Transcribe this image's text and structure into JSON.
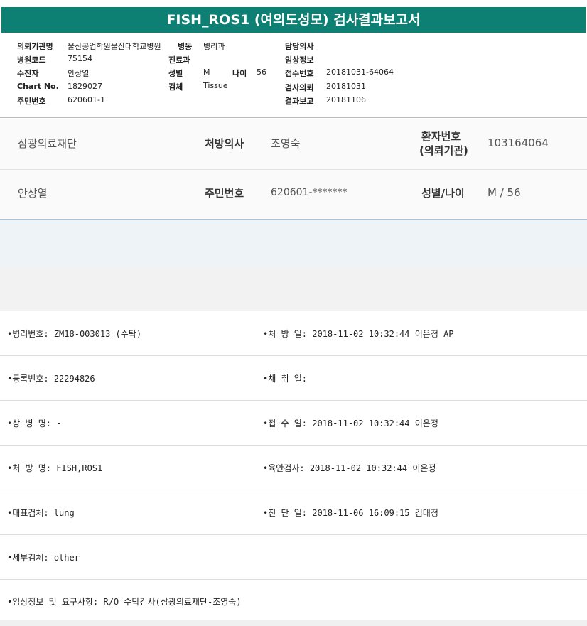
{
  "title": "FISH_ROS1 (여의도성모) 검사결과보고서",
  "header": {
    "institution_label": "의뢰기관명",
    "institution_value": "울산공업학원울산대학교병원",
    "ward_label": "병동",
    "ward_value": "병리과",
    "doctor_label": "담당의사",
    "doctor_value": "",
    "hospital_code_label": "병원코드",
    "hospital_code_value": "75154",
    "dept_label": "진료과",
    "dept_value": "",
    "clinical_info_label": "임상정보",
    "clinical_info_value": "",
    "patient_label": "수진자",
    "patient_value": "안상열",
    "sex_label": "성별",
    "sex_value": "M",
    "age_label": "나이",
    "age_value": "56",
    "receipt_no_label": "접수번호",
    "receipt_no_value": "20181031-64064",
    "chart_label": "Chart No.",
    "chart_value": "1829027",
    "specimen_label": "검체",
    "specimen_value": "Tissue",
    "request_label": "검사의뢰",
    "request_value": "20181031",
    "rrn_label": "주민번호",
    "rrn_value": "620601-1",
    "report_label": "결과보고",
    "report_value": "20181106"
  },
  "patient_bar": {
    "foundation": "삼광의료재단",
    "prescriber_label": "처방의사",
    "prescriber_value": "조영숙",
    "pid_label_line1": "환자번호",
    "pid_label_line2": "(의뢰기관)",
    "pid_value": "103164064",
    "name": "안상열",
    "rrn_label": "주민번호",
    "rrn_value": "620601-*******",
    "sexage_label": "성별/나이",
    "sexage_value": "M / 56"
  },
  "details": [
    {
      "left": "•병리번호: ZM18-003013 (수탁)",
      "right": "•처 방 일: 2018-11-02 10:32:44  이은정 AP"
    },
    {
      "left": "•등록번호: 22294826",
      "right": "•채 취 일:"
    },
    {
      "left": "•상 병 명: -",
      "right": "•접 수 일: 2018-11-02 10:32:44  이은정"
    },
    {
      "left": "•처 방 명: FISH,ROS1",
      "right": "•육안검사: 2018-11-02 10:32:44  이은정"
    },
    {
      "left": "•대표검체: lung",
      "right": "•진 단 일: 2018-11-06 16:09:15  김태정"
    },
    {
      "left": "•세부검체: other",
      "right": ""
    },
    {
      "left": "•임상정보 및 요구사항: R/O 수탁검사(삼광의료재단-조영숙)",
      "right": ""
    }
  ],
  "colors": {
    "title_band": "#0d7f73",
    "blue_band": "#eef3f8",
    "gray_band": "#f2f2f2"
  }
}
